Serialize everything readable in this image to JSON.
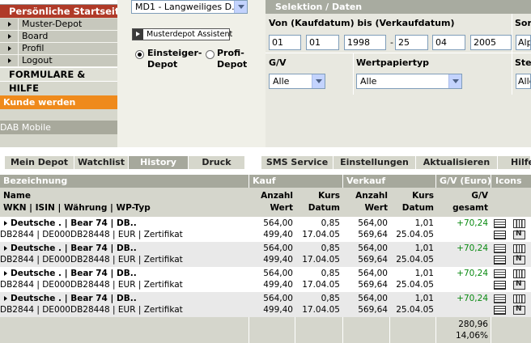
{
  "sidebar": {
    "section_title": "Persönliche Startseite",
    "items": [
      {
        "label": "Muster-Depot"
      },
      {
        "label": "Board"
      },
      {
        "label": "Profil"
      },
      {
        "label": "Logout"
      }
    ],
    "formulare": "FORMULARE & HILFE",
    "kunde": "Kunde werden",
    "dab": "DAB Mobile"
  },
  "depot": {
    "select_value": "MD1 - Langweiliges D.",
    "assistant_label": "Musterdepot Assistent",
    "radio1_line1": "Einsteiger-",
    "radio1_line2": "Depot",
    "radio2_line1": "Profi-",
    "radio2_line2": "Depot"
  },
  "selektion": {
    "title": "Selektion / Daten",
    "date_label": "Von (Kaufdatum) bis (Verkaufdatum)",
    "sort_label": "Sor",
    "from_day": "01",
    "from_month": "01",
    "from_year": "1998",
    "to_day": "25",
    "to_month": "04",
    "to_year": "2005",
    "sort_value": "Alp",
    "gv_label": "G/V",
    "gv_value": "Alle",
    "wptyp_label": "Wertpapiertyp",
    "wptyp_value": "Alle",
    "ste_label": "Ste",
    "ste_value": "Alle"
  },
  "tabs": [
    {
      "label": "Mein Depot",
      "active": false
    },
    {
      "label": "Watchlist",
      "active": false
    },
    {
      "label": "History",
      "active": true
    },
    {
      "label": "Druck",
      "active": false
    },
    {
      "label": "SMS Service",
      "active": false
    },
    {
      "label": "Einstellungen",
      "active": false
    },
    {
      "label": "Aktualisieren",
      "active": false
    },
    {
      "label": "Hilfe",
      "active": false
    }
  ],
  "table": {
    "group_headers": {
      "bezeichnung": "Bezeichnung",
      "kauf": "Kauf",
      "verkauf": "Verkauf",
      "gv": "G/V (Euro)",
      "icons": "Icons"
    },
    "sub_headers": {
      "name_line1": "Name",
      "name_line2": "WKN | ISIN | Währung | WP-Typ",
      "anzahl_line1": "Anzahl",
      "anzahl_line2": "Wert",
      "kurs_line1": "Kurs",
      "kurs_line2": "Datum",
      "gv_line1": "G/V",
      "gv_line2": "gesamt"
    },
    "rows": [
      {
        "name": "Deutsche . | Bear 74 | DB..",
        "ident": "DB2844 | DE000DB28448 | EUR | Zertifikat",
        "kauf_anzahl": "564,00",
        "kauf_wert": "499,40",
        "kauf_kurs": "0,85",
        "kauf_datum": "17.04.05",
        "vk_anzahl": "564,00",
        "vk_wert": "569,64",
        "vk_kurs": "1,01",
        "vk_datum": "25.04.05",
        "gv": "+70,24"
      },
      {
        "name": "Deutsche . | Bear 74 | DB..",
        "ident": "DB2844 | DE000DB28448 | EUR | Zertifikat",
        "kauf_anzahl": "564,00",
        "kauf_wert": "499,40",
        "kauf_kurs": "0,85",
        "kauf_datum": "17.04.05",
        "vk_anzahl": "564,00",
        "vk_wert": "569,64",
        "vk_kurs": "1,01",
        "vk_datum": "25.04.05",
        "gv": "+70,24"
      },
      {
        "name": "Deutsche . | Bear 74 | DB..",
        "ident": "DB2844 | DE000DB28448 | EUR | Zertifikat",
        "kauf_anzahl": "564,00",
        "kauf_wert": "499,40",
        "kauf_kurs": "0,85",
        "kauf_datum": "17.04.05",
        "vk_anzahl": "564,00",
        "vk_wert": "569,64",
        "vk_kurs": "1,01",
        "vk_datum": "25.04.05",
        "gv": "+70,24"
      },
      {
        "name": "Deutsche . | Bear 74 | DB..",
        "ident": "DB2844 | DE000DB28448 | EUR | Zertifikat",
        "kauf_anzahl": "564,00",
        "kauf_wert": "499,40",
        "kauf_kurs": "0,85",
        "kauf_datum": "17.04.05",
        "vk_anzahl": "564,00",
        "vk_wert": "569,64",
        "vk_kurs": "1,01",
        "vk_datum": "25.04.05",
        "gv": "+70,24"
      }
    ],
    "total_gv": "280,96",
    "total_pct": "14,06%"
  },
  "colors": {
    "sidebar_red": "#b03a28",
    "kunde_orange": "#ef8a1c",
    "header_gray": "#a6a89c",
    "gv_green": "#0a8a12"
  }
}
